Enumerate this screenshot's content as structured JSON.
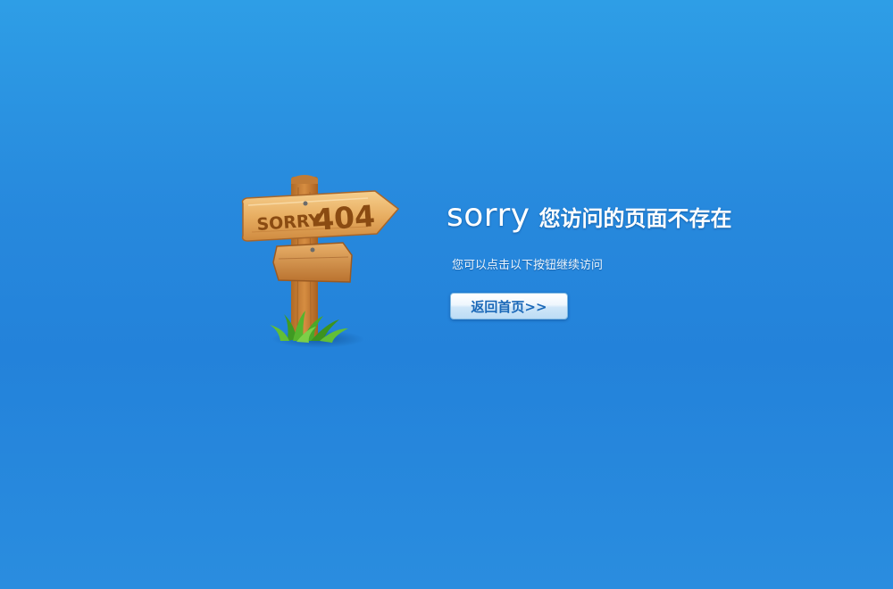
{
  "sign": {
    "sorry_label": "SORRY",
    "code_label": "404"
  },
  "message": {
    "sorry_word": "sorry",
    "headline": "您访问的页面不存在",
    "subtext": "您可以点击以下按钮继续访问"
  },
  "actions": {
    "home_button_label": "返回首页>>"
  },
  "colors": {
    "background_top": "#2e9ee6",
    "background_mid": "#2382da",
    "button_text": "#1a68b8",
    "wood": "#e2a35a",
    "wood_text": "#8a4b12"
  },
  "icons": {
    "signpost": "wooden-signpost-404-illustration",
    "grass": "grass-tuft-icon"
  }
}
